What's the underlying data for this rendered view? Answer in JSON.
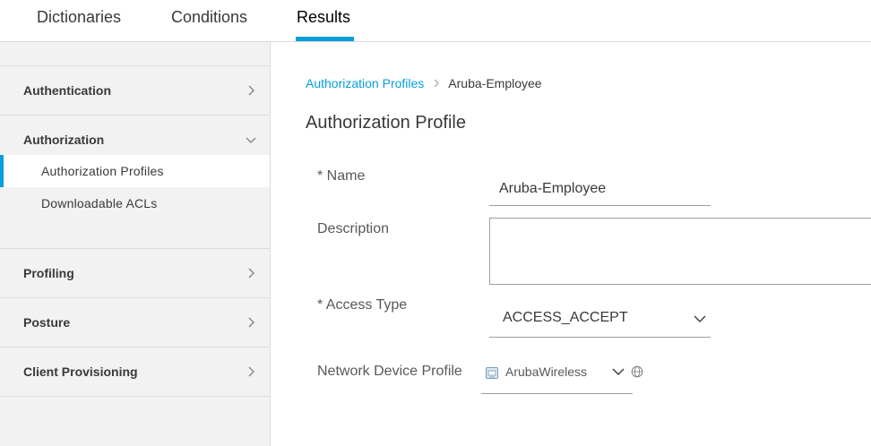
{
  "tabs": [
    {
      "label": "Dictionaries"
    },
    {
      "label": "Conditions"
    },
    {
      "label": "Results",
      "active": true
    }
  ],
  "sidebar": {
    "sections": [
      {
        "label": "Authentication",
        "expanded": false
      },
      {
        "label": "Authorization",
        "expanded": true,
        "items": [
          {
            "label": "Authorization Profiles",
            "active": true
          },
          {
            "label": "Downloadable ACLs",
            "active": false
          }
        ]
      },
      {
        "label": "Profiling",
        "expanded": false
      },
      {
        "label": "Posture",
        "expanded": false
      },
      {
        "label": "Client Provisioning",
        "expanded": false
      }
    ]
  },
  "breadcrumb": {
    "link": "Authorization Profiles",
    "current": "Aruba-Employee"
  },
  "page_title": "Authorization Profile",
  "form": {
    "name_label": "* Name",
    "name_value": "Aruba-Employee",
    "description_label": "Description",
    "description_value": "",
    "access_type_label": "* Access Type",
    "access_type_value": "ACCESS_ACCEPT",
    "ndp_label": "Network Device Profile",
    "ndp_value": "ArubaWireless"
  },
  "colors": {
    "accent": "#049fd9",
    "sidebar_bg": "#f2f2f2",
    "text": "#39393b"
  },
  "icons": {
    "chevron_right": "chevron-right-icon",
    "chevron_down": "chevron-down-icon",
    "device": "network-device-icon",
    "globe": "globe-icon"
  }
}
